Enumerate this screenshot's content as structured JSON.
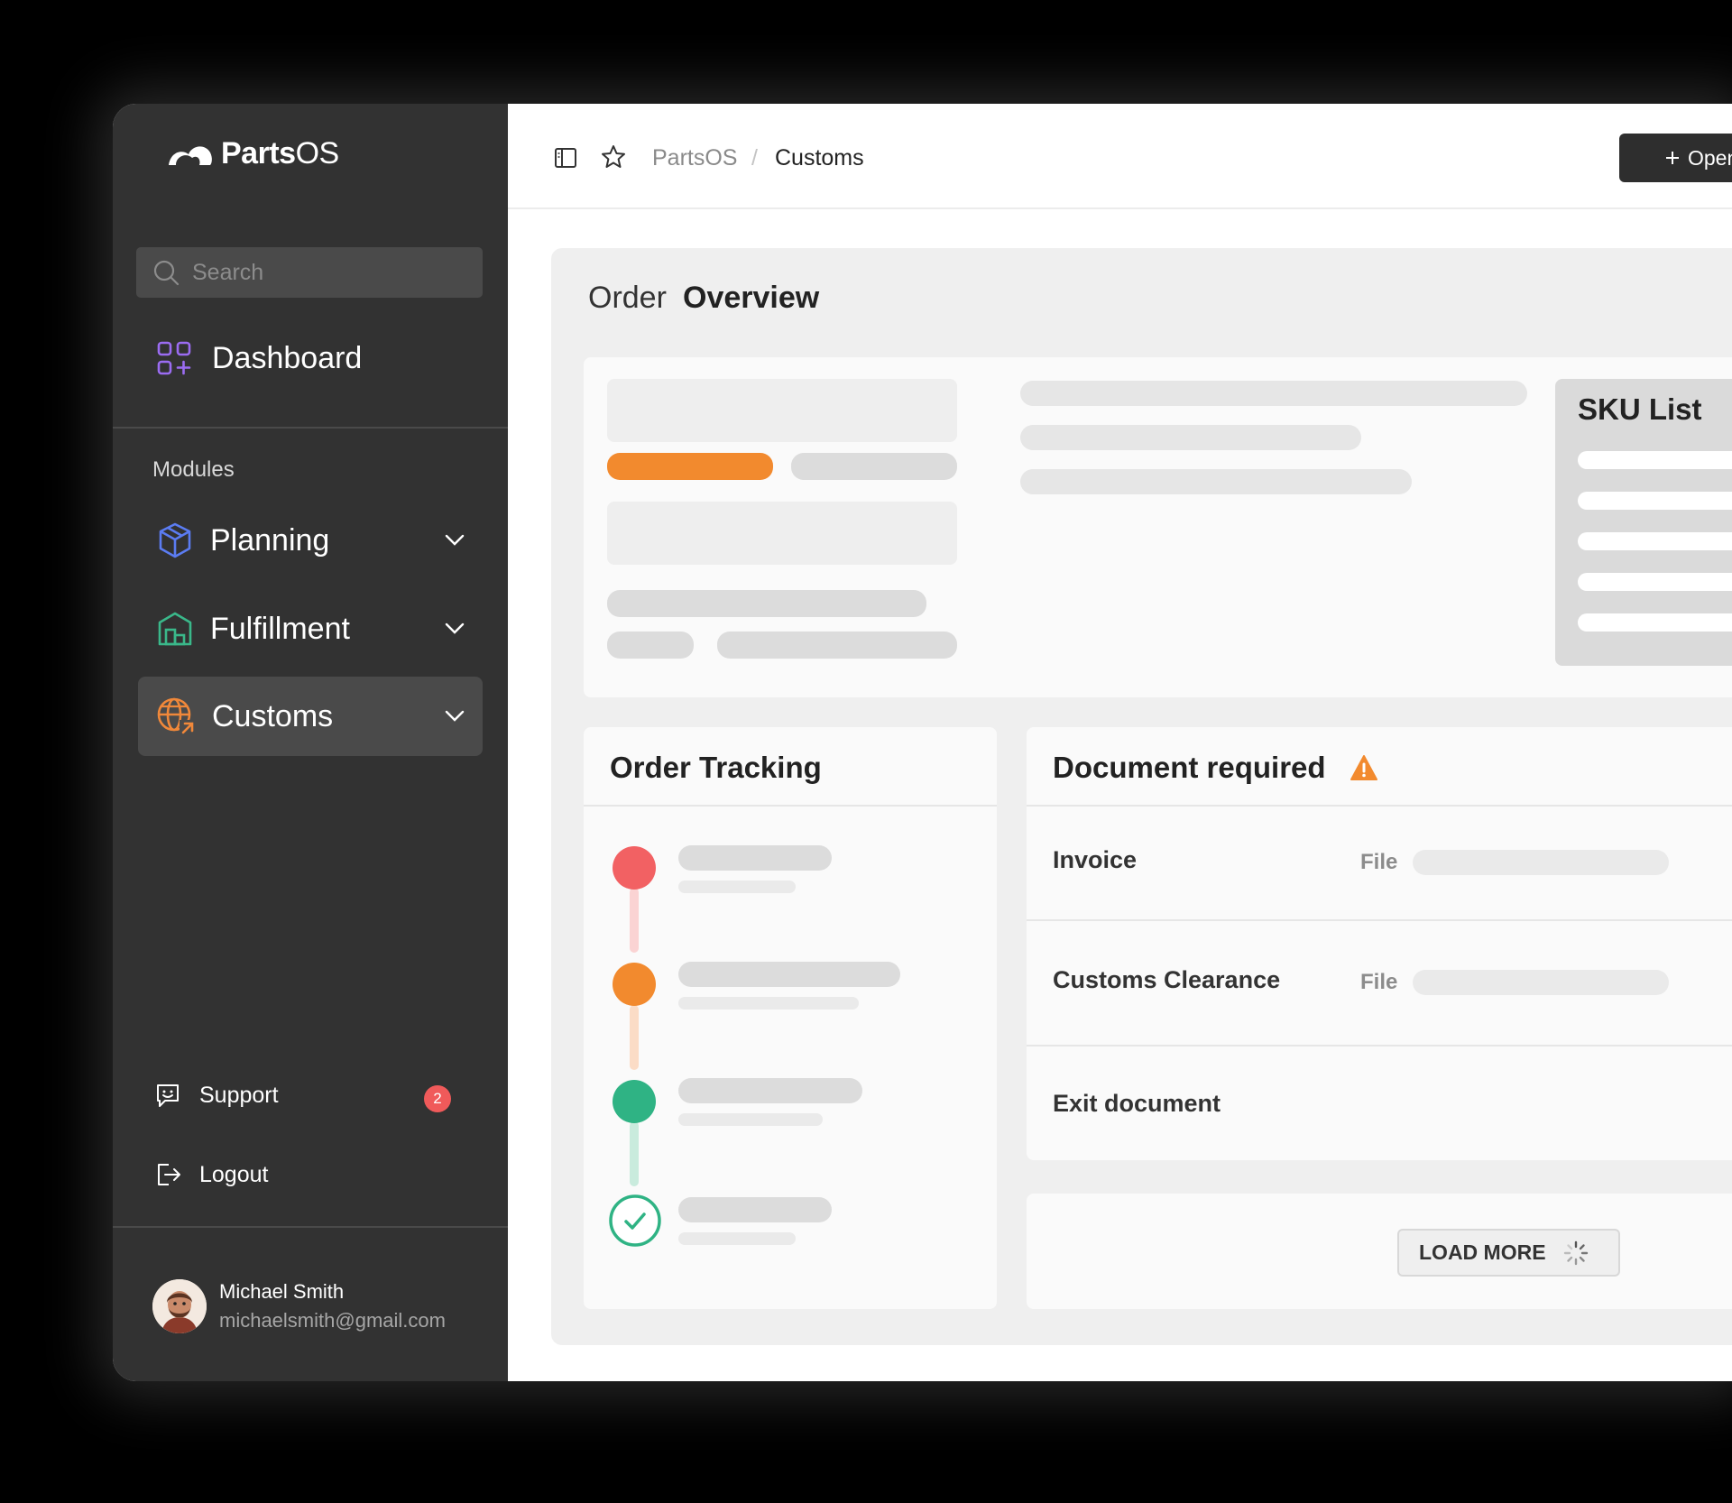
{
  "app": {
    "name_bold": "Parts",
    "name_light": "OS"
  },
  "search": {
    "placeholder": "Search"
  },
  "sidebar": {
    "dashboard_label": "Dashboard",
    "modules_label": "Modules",
    "items": [
      {
        "label": "Planning",
        "icon": "cube-icon",
        "color": "#5b7cf2"
      },
      {
        "label": "Fulfillment",
        "icon": "warehouse-icon",
        "color": "#3ab88a"
      },
      {
        "label": "Customs",
        "icon": "globe-arrow-icon",
        "color": "#f0883a",
        "active": true
      }
    ],
    "support_label": "Support",
    "support_badge": "2",
    "logout_label": "Logout"
  },
  "user": {
    "name": "Michael Smith",
    "email": "michaelsmith@gmail.com"
  },
  "breadcrumb": {
    "root": "PartsOS",
    "separator": "/",
    "current": "Customs"
  },
  "topbar": {
    "open_button_label": "Open"
  },
  "main": {
    "title_light": "Order",
    "title_bold": "Overview",
    "sku_title": "SKU List",
    "tracking_title": "Order Tracking",
    "tracking_colors": [
      "#f26163",
      "#f28a2e",
      "#2fb384",
      "#2fb384"
    ],
    "document_title": "Document required",
    "documents": [
      {
        "label": "Invoice",
        "file_label": "File"
      },
      {
        "label": "Customs Clearance",
        "file_label": "File"
      },
      {
        "label": "Exit document"
      }
    ],
    "load_more_label": "LOAD MORE"
  },
  "colors": {
    "accent_orange": "#f28a2e",
    "sidebar_bg": "#323232",
    "badge_red": "#f05a5a"
  }
}
